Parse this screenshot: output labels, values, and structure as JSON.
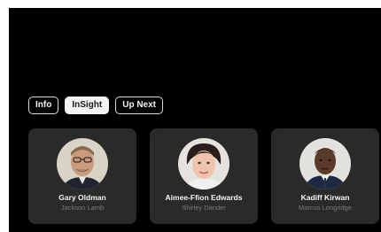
{
  "tabs": [
    {
      "label": "Info",
      "active": false
    },
    {
      "label": "InSight",
      "active": true
    },
    {
      "label": "Up Next",
      "active": false
    }
  ],
  "cast": [
    {
      "name": "Gary Oldman",
      "role": "Jackson Lamb",
      "icon": "avatar-gary-oldman"
    },
    {
      "name": "Aimee-Ffion Edwards",
      "role": "Shirley Dander",
      "icon": "avatar-aimee-ffion-edwards"
    },
    {
      "name": "Kadiff Kirwan",
      "role": "Marcus Longridge",
      "icon": "avatar-kadiff-kirwan"
    }
  ],
  "colors": {
    "background": "#000000",
    "card": "#2a2a2a",
    "active_tab": "#f4f4f4",
    "secondary_text": "#7a7a7a"
  }
}
